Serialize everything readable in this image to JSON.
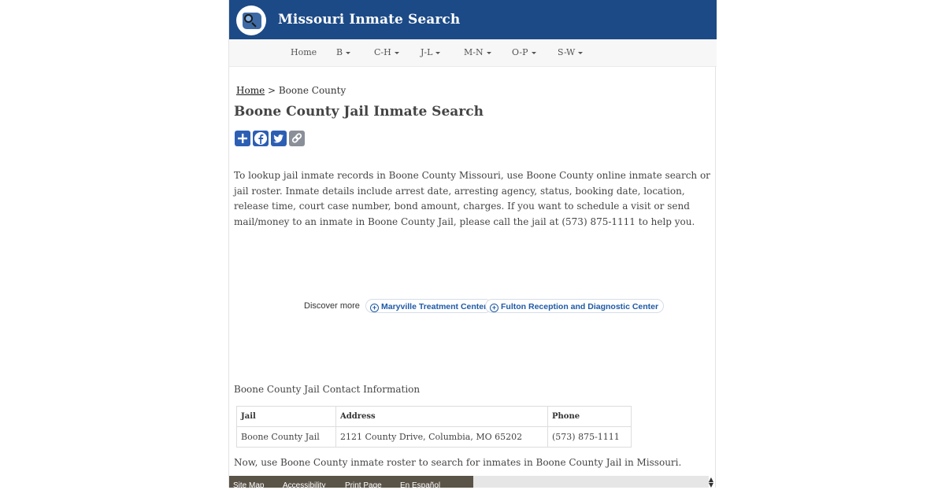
{
  "site": {
    "title": "Missouri Inmate Search"
  },
  "nav": {
    "items": [
      "Home",
      "B",
      "C-H",
      "J-L",
      "M-N",
      "O-P",
      "S-W"
    ]
  },
  "breadcrumb": {
    "home": "Home",
    "separator": " > ",
    "current": "Boone County"
  },
  "page": {
    "title": "Boone County Jail Inmate Search",
    "intro": "To lookup jail inmate records in Boone County Missouri, use Boone County online inmate search or jail roster. Inmate details include arrest date, arresting agency, status, booking date, location, release time, court case number, bond amount, charges. If you want to schedule a visit or send mail/money to an inmate in Boone County Jail, please call the jail at (573) 875-1111 to help you."
  },
  "share": {
    "buttons": [
      "share-plus-icon",
      "facebook-icon",
      "twitter-icon",
      "copy-link-icon"
    ],
    "colors": {
      "button_bg": "#2c5fb3"
    }
  },
  "discover": {
    "label": "Discover more",
    "chips": [
      "Maryville Treatment Center",
      "Fulton Reception and Diagnostic Center"
    ]
  },
  "contact": {
    "heading": "Boone County Jail Contact Information",
    "columns": [
      "Jail",
      "Address",
      "Phone"
    ],
    "rows": [
      [
        "Boone County Jail",
        "2121 County Drive, Columbia, MO 65202",
        "(573) 875-1111"
      ]
    ]
  },
  "outro": "Now, use Boone County inmate roster to search for inmates in Boone County Jail in Missouri.",
  "footer": {
    "links": [
      "Site Map",
      "Accessibility",
      "Print Page",
      "En Español"
    ]
  },
  "colors": {
    "header": "#1c4a87",
    "footer": "#5a5348",
    "link": "#1f5aa6"
  }
}
